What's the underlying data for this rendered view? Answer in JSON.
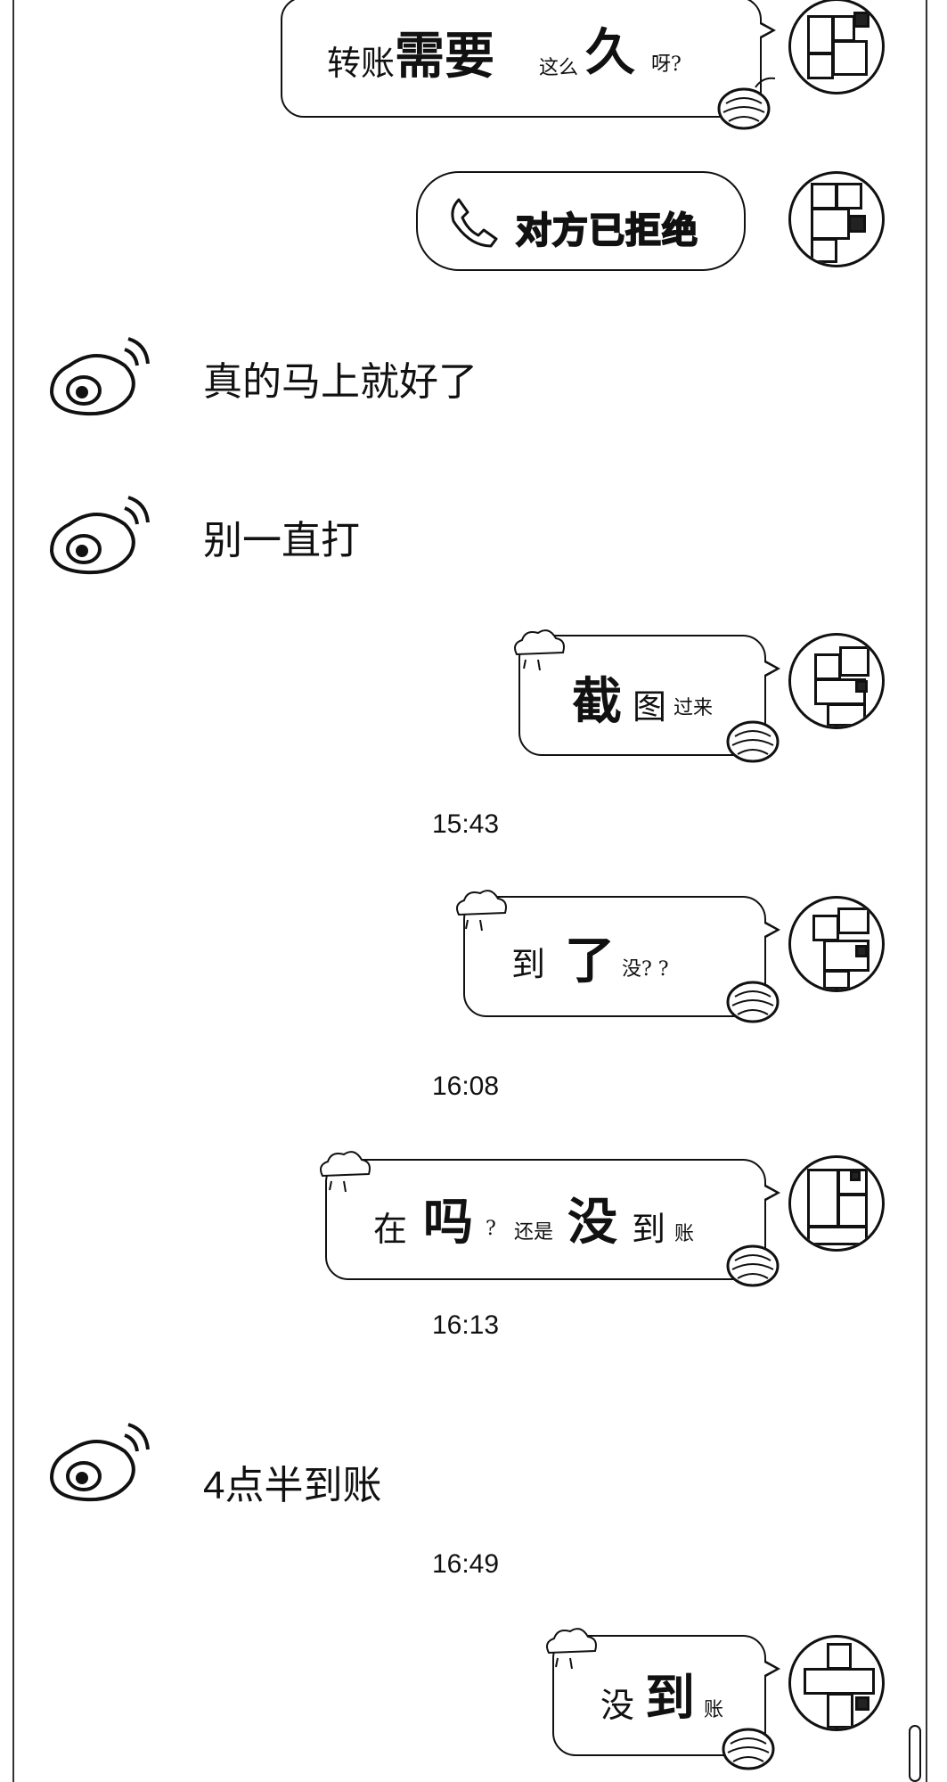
{
  "messages": [
    {
      "side": "self",
      "type": "stylized",
      "parts": [
        "转账",
        "需要",
        "这么",
        "久",
        "呀?"
      ]
    },
    {
      "side": "self",
      "type": "call",
      "icon": "phone-icon",
      "text": "对方已拒绝"
    },
    {
      "side": "other",
      "type": "text",
      "text": "真的马上就好了"
    },
    {
      "side": "other",
      "type": "text",
      "text": "别一直打"
    },
    {
      "side": "self",
      "type": "stylized",
      "parts": [
        "截",
        "图",
        "过来"
      ]
    },
    {
      "type": "time",
      "text": "15:43"
    },
    {
      "side": "self",
      "type": "stylized",
      "parts": [
        "到",
        "了",
        "没? ?"
      ]
    },
    {
      "type": "time",
      "text": "16:08"
    },
    {
      "side": "self",
      "type": "stylized",
      "parts": [
        "在",
        "吗",
        "?",
        "还是",
        "没",
        "到",
        "账"
      ]
    },
    {
      "type": "time",
      "text": "16:13"
    },
    {
      "side": "other",
      "type": "text",
      "text": "4点半到账"
    },
    {
      "type": "time",
      "text": "16:49"
    },
    {
      "side": "self",
      "type": "stylized",
      "parts": [
        "没",
        "到",
        "账"
      ]
    }
  ],
  "icons": {
    "self_avatar": "qr-pattern-avatar-icon",
    "other_avatar": "weibo-logo-icon",
    "bubble_deco": [
      "cloud-icon",
      "sprout-icon",
      "watermelon-icon"
    ]
  },
  "colors": {
    "ink": "#111111",
    "background": "#ffffff"
  }
}
